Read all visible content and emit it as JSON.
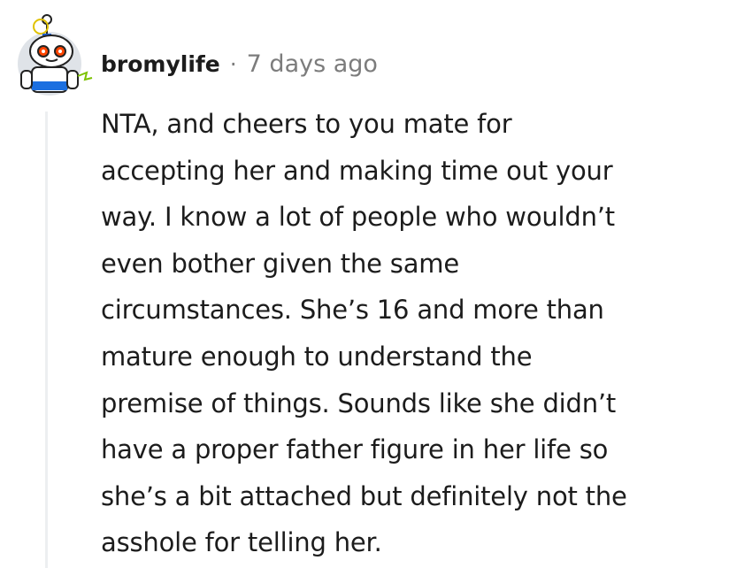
{
  "comment": {
    "username": "bromylife",
    "separator": "·",
    "timestamp": "7 days ago",
    "body_lines": [
      "NTA, and cheers to you mate for",
      "accepting her and making time out your",
      "way. I know a lot of people who wouldn’t",
      "even bother given the same",
      "circumstances. She’s 16 and more than",
      "mature enough to understand the",
      "premise of things. Sounds like she didn’t",
      "have a proper father figure in her life so",
      "she’s a bit attached but definitely not the",
      "asshole for telling her."
    ]
  },
  "colors": {
    "text": "#1c1c1c",
    "meta": "#7c7c7c",
    "thread_line": "#edeff1",
    "avatar_blue": "#0079d3",
    "avatar_orange": "#ff4500"
  },
  "icons": {
    "avatar": "snoo-robot-avatar"
  }
}
